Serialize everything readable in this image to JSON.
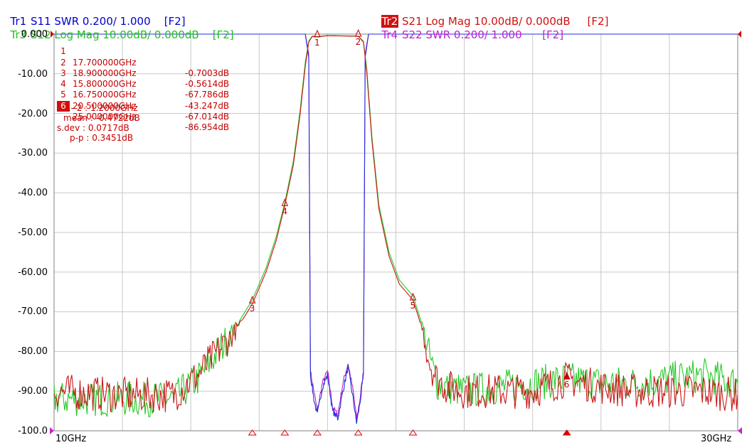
{
  "traces": [
    {
      "id": "tr1",
      "tag": "Tr1",
      "desc": "S11 SWR 0.200/ 1.000",
      "fkey": "[F2]",
      "color": "#0000d0",
      "active": false
    },
    {
      "id": "tr2",
      "tag": "Tr2",
      "desc": "S21 Log Mag 10.00dB/ 0.000dB",
      "fkey": "[F2]",
      "color": "#d01010",
      "active": true
    },
    {
      "id": "tr3",
      "tag": "Tr3",
      "desc": "S12 Log Mag 10.00dB/ 0.000dB",
      "fkey": "[F2]",
      "color": "#20c020",
      "active": false
    },
    {
      "id": "tr4",
      "tag": "Tr4",
      "desc": "S22 SWR 0.200/ 1.000",
      "fkey": "[F2]",
      "color": "#c020d0",
      "active": false
    }
  ],
  "markers": [
    {
      "num": "1",
      "freq": "17.700000GHz",
      "value": "-0.7003dB",
      "active": false
    },
    {
      "num": "2",
      "freq": "18.900000GHz",
      "value": "-0.5614dB",
      "active": false
    },
    {
      "num": "3",
      "freq": "15.800000GHz",
      "value": "-67.786dB",
      "active": false
    },
    {
      "num": "4",
      "freq": "16.750000GHz",
      "value": "-43.247dB",
      "active": false
    },
    {
      "num": "5",
      "freq": "20.500000GHz",
      "value": "-67.014dB",
      "active": false
    },
    {
      "num": "6",
      "freq": "25.000000GHz",
      "value": "-86.954dB",
      "active": true
    }
  ],
  "stats": {
    "span": "1- 2 : 1.2000GHz",
    "mean": "mean : -0.4722dB",
    "sdev": "s.dev : 0.0717dB",
    "pp": "p-p : 0.3451dB"
  },
  "axes": {
    "y_ticks": [
      "0.000",
      "-10.00",
      "-20.00",
      "-30.00",
      "-40.00",
      "-50.00",
      "-60.00",
      "-70.00",
      "-80.00",
      "-90.00",
      "-100.0"
    ],
    "x_start_label": "10GHz",
    "x_stop_label": "30GHz"
  },
  "chart_data": {
    "type": "line",
    "x_unit": "GHz",
    "xlim": [
      10,
      30
    ],
    "ylim": [
      -100,
      0
    ],
    "grid": true,
    "series": [
      {
        "name": "Tr2 S21 Log Mag",
        "color": "#c81818",
        "x": [
          10,
          12,
          13.5,
          14.2,
          14.8,
          15.3,
          15.8,
          16.2,
          16.5,
          16.75,
          17.0,
          17.2,
          17.35,
          17.45,
          17.55,
          17.7,
          18.0,
          18.3,
          18.6,
          18.9,
          19.05,
          19.15,
          19.3,
          19.5,
          19.8,
          20.1,
          20.5,
          20.8,
          21.0,
          21.2,
          21.5,
          22,
          23,
          24,
          25,
          26,
          27,
          28,
          29,
          30
        ],
        "y": [
          -90,
          -91,
          -91,
          -86,
          -80,
          -75,
          -68,
          -60,
          -52,
          -43.2,
          -33,
          -20,
          -8,
          -2,
          -0.6,
          -0.7,
          -0.4,
          -0.45,
          -0.5,
          -0.56,
          -2,
          -10,
          -27,
          -44,
          -56,
          -63,
          -67,
          -75,
          -83,
          -87,
          -89,
          -90,
          -90,
          -90,
          -87,
          -89,
          -90,
          -90,
          -90,
          -91
        ]
      },
      {
        "name": "Tr3 S12 Log Mag",
        "color": "#28c828",
        "x": [
          10,
          12,
          13.5,
          14.2,
          14.8,
          15.3,
          15.8,
          16.2,
          16.5,
          16.75,
          17.0,
          17.2,
          17.35,
          17.45,
          17.55,
          17.7,
          18.0,
          18.3,
          18.6,
          18.9,
          19.05,
          19.15,
          19.3,
          19.5,
          19.8,
          20.1,
          20.5,
          20.8,
          21.0,
          21.2,
          21.5,
          22,
          23,
          24,
          25,
          26,
          27,
          28,
          29,
          30
        ],
        "y": [
          -92,
          -92,
          -92,
          -87,
          -80,
          -74,
          -67,
          -59,
          -51,
          -42.5,
          -32,
          -19,
          -7,
          -1.8,
          -0.5,
          -0.6,
          -0.35,
          -0.4,
          -0.45,
          -0.5,
          -1.8,
          -9,
          -26,
          -43,
          -55,
          -62,
          -66,
          -74,
          -82,
          -88,
          -89,
          -90,
          -89,
          -88,
          -87,
          -88,
          -88,
          -87,
          -86,
          -88
        ]
      },
      {
        "name": "Tr4 S22 SWR",
        "color": "#b820c8",
        "x": [
          10,
          17.35,
          17.45,
          17.5,
          17.6,
          17.7,
          17.85,
          18.0,
          18.15,
          18.3,
          18.45,
          18.6,
          18.75,
          18.85,
          18.95,
          19.05,
          19.1,
          19.2,
          30
        ],
        "y": [
          0,
          0,
          -5,
          -85,
          -90,
          -95,
          -88,
          -85,
          -94,
          -96,
          -88,
          -83,
          -90,
          -97,
          -92,
          -85,
          -5,
          0,
          0
        ]
      },
      {
        "name": "Tr1 S11 SWR",
        "color": "#2030d8",
        "x": [
          10,
          17.35,
          17.45,
          17.5,
          17.6,
          17.7,
          17.85,
          18.0,
          18.15,
          18.3,
          18.45,
          18.6,
          18.75,
          18.85,
          18.95,
          19.05,
          19.1,
          19.2,
          30
        ],
        "y": [
          0,
          0,
          -6,
          -86,
          -92,
          -96,
          -89,
          -86,
          -95,
          -97,
          -90,
          -84,
          -92,
          -98,
          -93,
          -86,
          -6,
          0,
          0
        ]
      }
    ],
    "markers": [
      {
        "label": "1",
        "x": 17.7,
        "y": -0.7003
      },
      {
        "label": "2",
        "x": 18.9,
        "y": -0.5614
      },
      {
        "label": "3",
        "x": 15.8,
        "y": -67.786
      },
      {
        "label": "4",
        "x": 16.75,
        "y": -43.247
      },
      {
        "label": "5",
        "x": 20.5,
        "y": -67.014
      },
      {
        "label": "6",
        "x": 25.0,
        "y": -86.954
      }
    ]
  }
}
